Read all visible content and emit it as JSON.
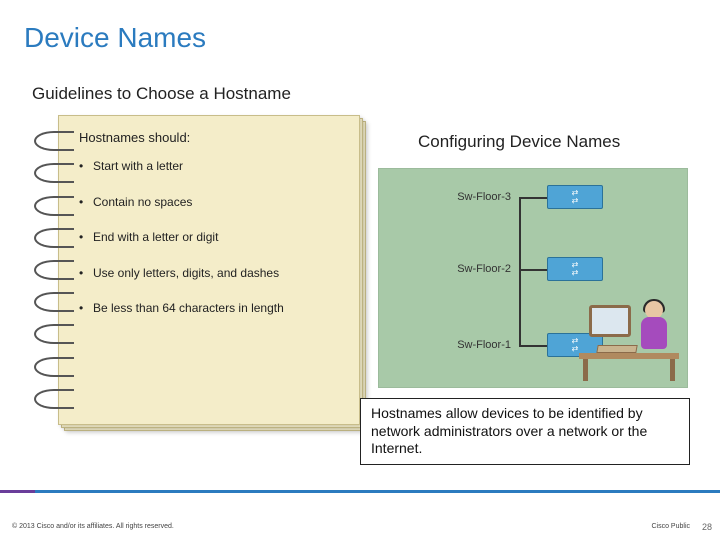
{
  "title": "Device Names",
  "subtitle": "Guidelines to Choose a Hostname",
  "notepad": {
    "heading": "Hostnames should:",
    "rules": [
      "Start with a letter",
      "Contain no spaces",
      "End with a letter or digit",
      "Use only letters, digits, and dashes",
      "Be less than 64 characters in length"
    ]
  },
  "right_title": "Configuring Device Names",
  "diagram": {
    "switches": [
      "Sw-Floor-3",
      "Sw-Floor-2",
      "Sw-Floor-1"
    ]
  },
  "callout": "Hostnames allow devices to be identified by network administrators over a network or the Internet.",
  "footer": {
    "copyright": "© 2013 Cisco and/or its affiliates. All rights reserved.",
    "classification": "Cisco Public",
    "page_number": "28"
  }
}
